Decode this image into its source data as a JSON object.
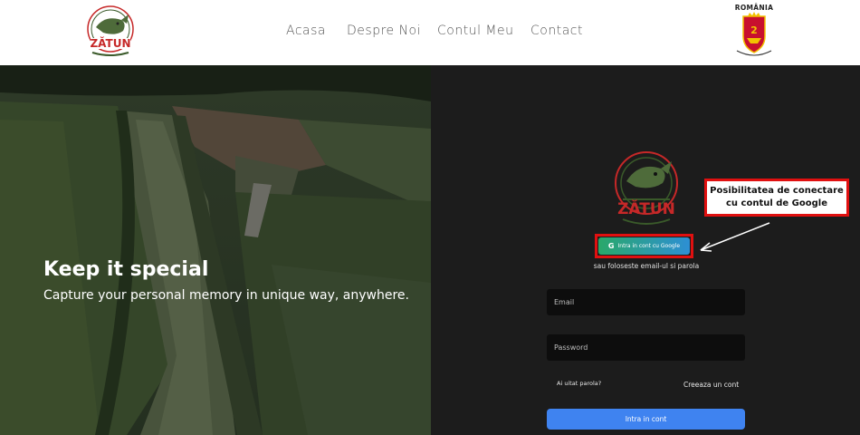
{
  "header": {
    "logo_text": "ZĂTUN",
    "nav": [
      {
        "label": "Acasa"
      },
      {
        "label": "Despre Noi"
      },
      {
        "label": "Contul Meu"
      },
      {
        "label": "Contact"
      }
    ],
    "crest_title": "ROMÂNIA"
  },
  "hero": {
    "title": "Keep it special",
    "subtitle": "Capture your personal memory in unique way, anywhere."
  },
  "login": {
    "logo_text": "ZĂTUN",
    "google_button": "Intra in cont cu Google",
    "or_text": "sau foloseste email-ul si parola",
    "callout_line1": "Posibilitatea de conectare",
    "callout_line2": "cu contul de Google",
    "email_placeholder": "Email",
    "password_placeholder": "Password",
    "forgot_link": "Ai uitat parola?",
    "create_link": "Creeaza un cont",
    "submit_label": "Intra in cont"
  },
  "colors": {
    "header_bg": "#ffffff",
    "panel_bg": "#1c1c1c",
    "submit_bg": "#3f83f0",
    "highlight_red": "#e01010",
    "logo_red": "#c62828",
    "logo_green": "#3a5a2a"
  },
  "icons": [
    "google-g-icon",
    "arrow-icon",
    "fish-logo-icon",
    "crest-icon"
  ]
}
